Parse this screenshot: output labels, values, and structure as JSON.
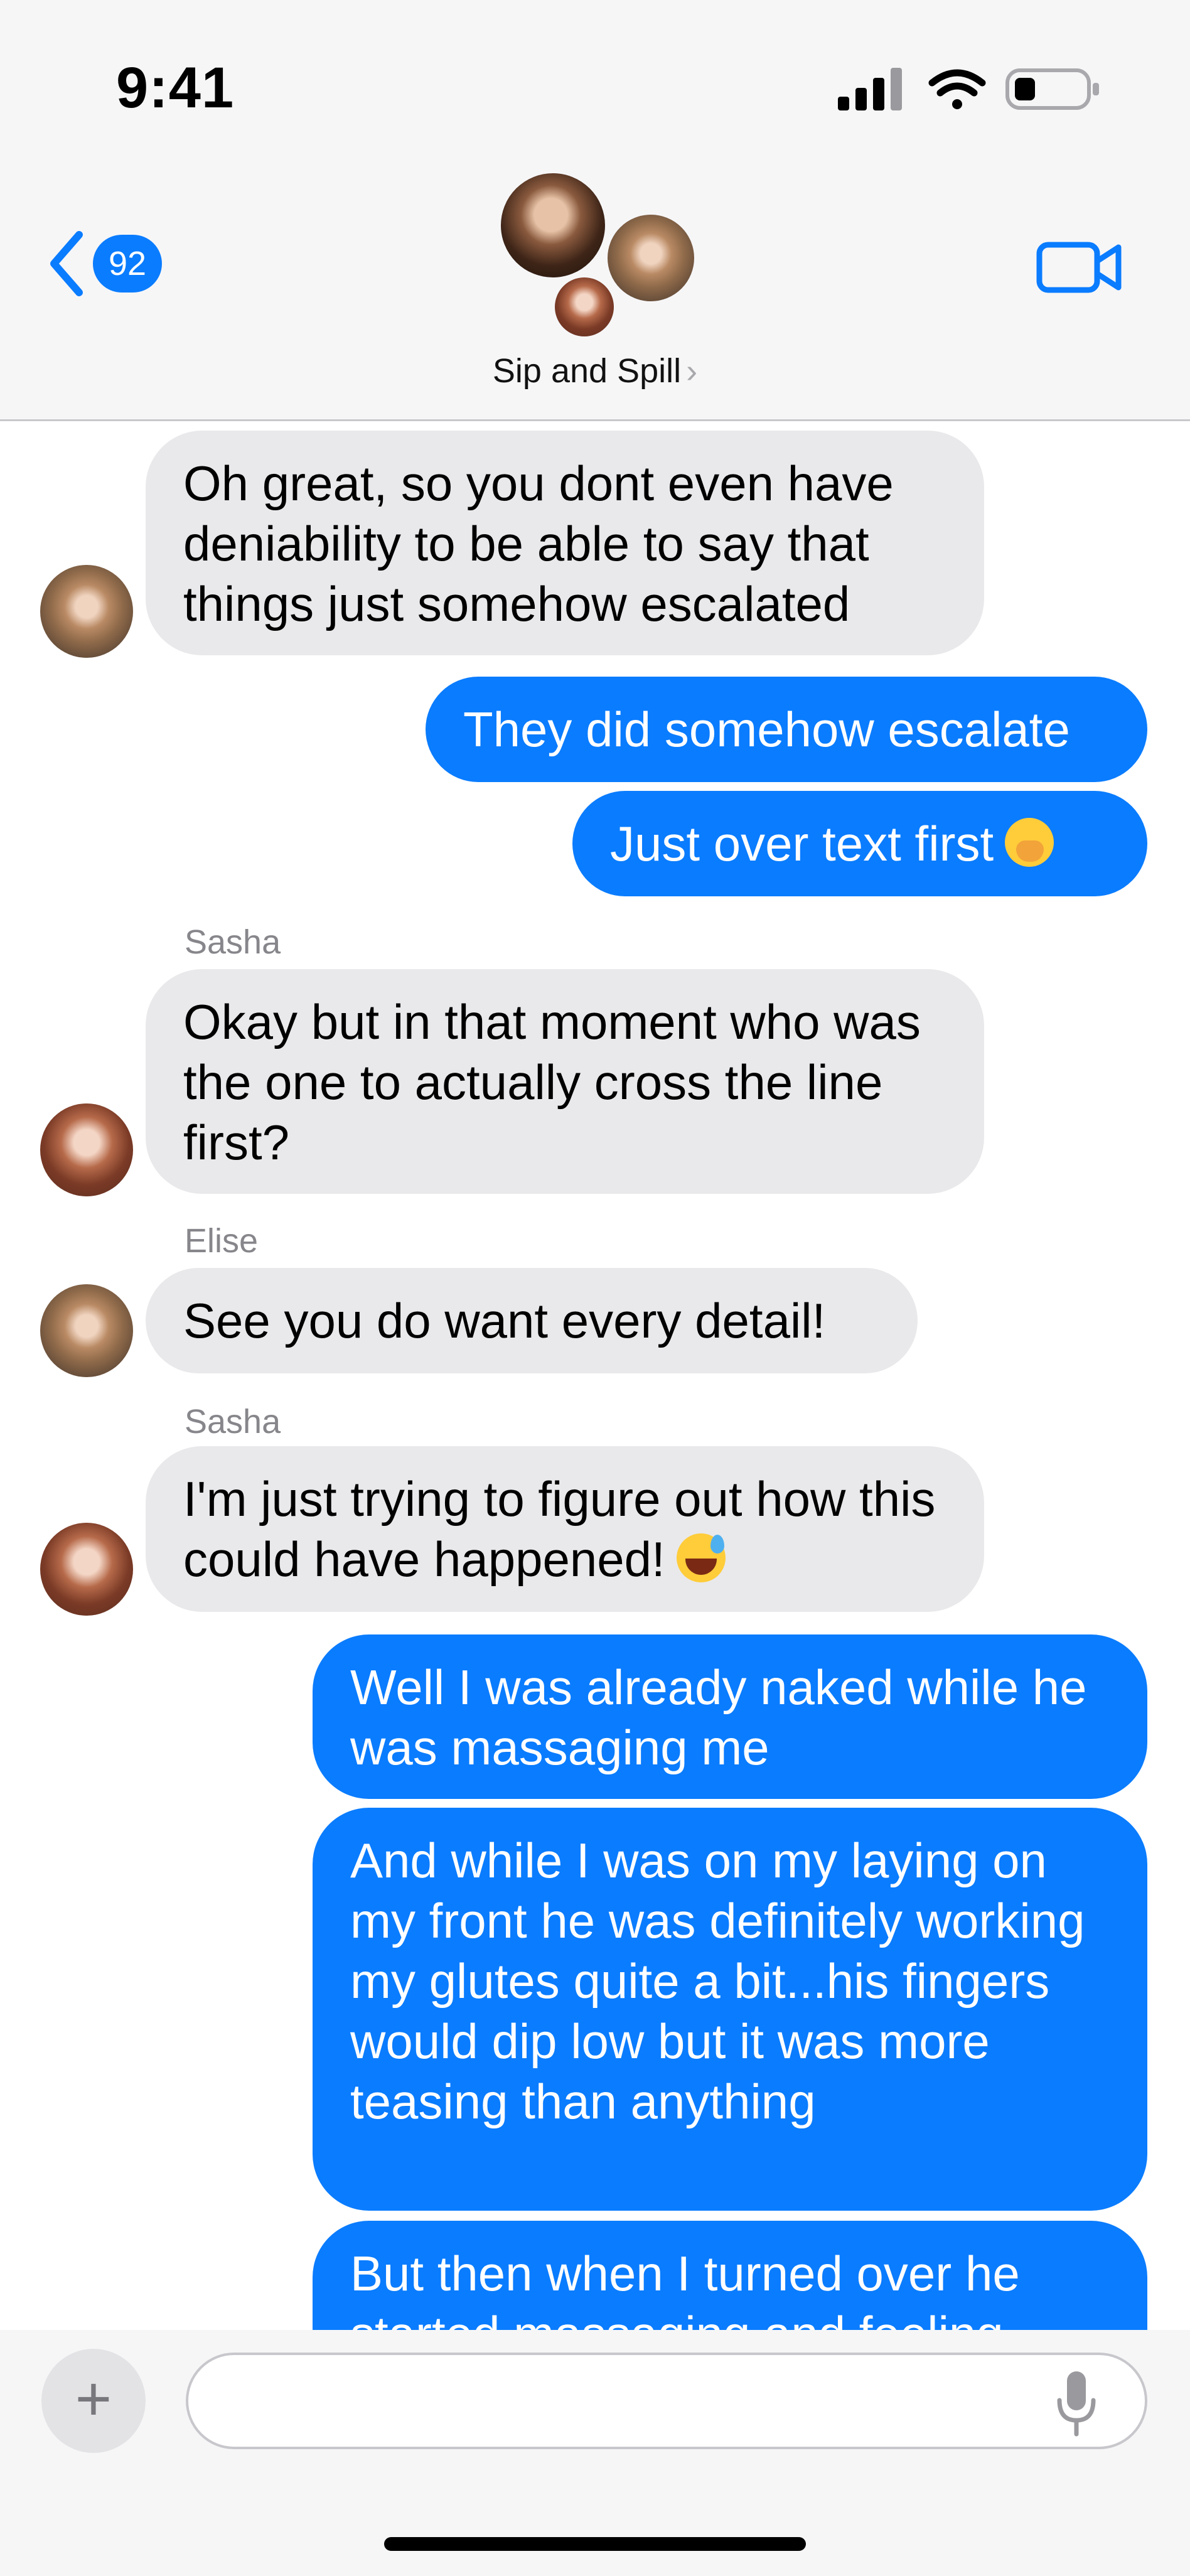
{
  "status_bar": {
    "time": "9:41",
    "icons": [
      "cellular-signal-icon",
      "wifi-icon",
      "battery-icon"
    ]
  },
  "header": {
    "back_badge_count": "92",
    "group_name": "Sip and Spill",
    "group_name_chevron": "›",
    "icons": [
      "back-chevron-icon",
      "video-call-icon"
    ]
  },
  "messages": [
    {
      "direction": "incoming",
      "sender": "",
      "text": "Oh great, so you dont even have deniability to be able to say that things just somehow escalated"
    },
    {
      "direction": "outgoing",
      "text": "They did somehow escalate"
    },
    {
      "direction": "outgoing",
      "text": "Just over text first",
      "emoji": "face-with-hand-over-mouth"
    },
    {
      "direction": "incoming",
      "sender": "Sasha",
      "text": "Okay but in that moment who was the one to actually cross the line first?"
    },
    {
      "direction": "incoming",
      "sender": "Elise",
      "text": "See you do want every detail!"
    },
    {
      "direction": "incoming",
      "sender": "Sasha",
      "text": "I'm just trying to figure out how this could have happened!",
      "emoji": "grinning-face-with-sweat"
    },
    {
      "direction": "outgoing",
      "text": "Well I was already naked while he was massaging me"
    },
    {
      "direction": "outgoing",
      "text": "And while I was on my laying on my front he was definitely working my glutes quite a bit...his fingers would dip low but it was more teasing than anything"
    },
    {
      "direction": "outgoing",
      "text": "But then when I turned over he started massaging and feeling"
    }
  ],
  "composer": {
    "placeholder": "",
    "icons": [
      "plus-icon",
      "microphone-icon"
    ]
  },
  "colors": {
    "accent": "#0a7cff",
    "incoming_bubble": "#e9e9eb",
    "header_bg": "#f6f6f7"
  }
}
